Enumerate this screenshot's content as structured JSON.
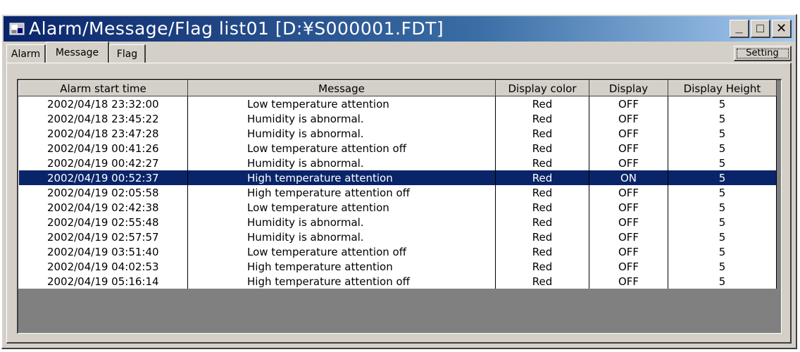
{
  "window": {
    "title": "Alarm/Message/Flag list01 [D:¥S000001.FDT]",
    "buttons": {
      "minimize": "_",
      "maximize": "□",
      "close": "✕"
    }
  },
  "tabs": [
    {
      "label": "Alarm",
      "active": false
    },
    {
      "label": "Message",
      "active": true
    },
    {
      "label": "Flag",
      "active": false
    }
  ],
  "setting_label": "Setting",
  "table": {
    "headers": [
      "Alarm start time",
      "Message",
      "Display color",
      "Display",
      "Display Height"
    ],
    "rows": [
      [
        "2002/04/18 23:32:00",
        "Low temperature attention",
        "Red",
        "OFF",
        "5"
      ],
      [
        "2002/04/18 23:45:22",
        "Humidity is abnormal.",
        "Red",
        "OFF",
        "5"
      ],
      [
        "2002/04/18 23:47:28",
        "Humidity is abnormal.",
        "Red",
        "OFF",
        "5"
      ],
      [
        "2002/04/19 00:41:26",
        "Low temperature attention off",
        "Red",
        "OFF",
        "5"
      ],
      [
        "2002/04/19 00:42:27",
        "Humidity is abnormal.",
        "Red",
        "OFF",
        "5"
      ],
      [
        "2002/04/19 00:52:37",
        "High temperature attention",
        "Red",
        "ON",
        "5"
      ],
      [
        "2002/04/19 02:05:58",
        "High temperature attention off",
        "Red",
        "OFF",
        "5"
      ],
      [
        "2002/04/19 02:42:38",
        "Low temperature attention",
        "Red",
        "OFF",
        "5"
      ],
      [
        "2002/04/19 02:55:48",
        "Humidity is abnormal.",
        "Red",
        "OFF",
        "5"
      ],
      [
        "2002/04/19 02:57:57",
        "Humidity is abnormal.",
        "Red",
        "OFF",
        "5"
      ],
      [
        "2002/04/19 03:51:40",
        "Low temperature attention off",
        "Red",
        "OFF",
        "5"
      ],
      [
        "2002/04/19 04:02:53",
        "High temperature attention",
        "Red",
        "OFF",
        "5"
      ],
      [
        "2002/04/19 05:16:14",
        "High temperature attention off",
        "Red",
        "OFF",
        "5"
      ]
    ],
    "selected_row": 5
  },
  "colors": {
    "titlebar_start": "#0a246a",
    "titlebar_end": "#a6caf0",
    "face": "#d4d0c8",
    "selection": "#0a246a"
  }
}
